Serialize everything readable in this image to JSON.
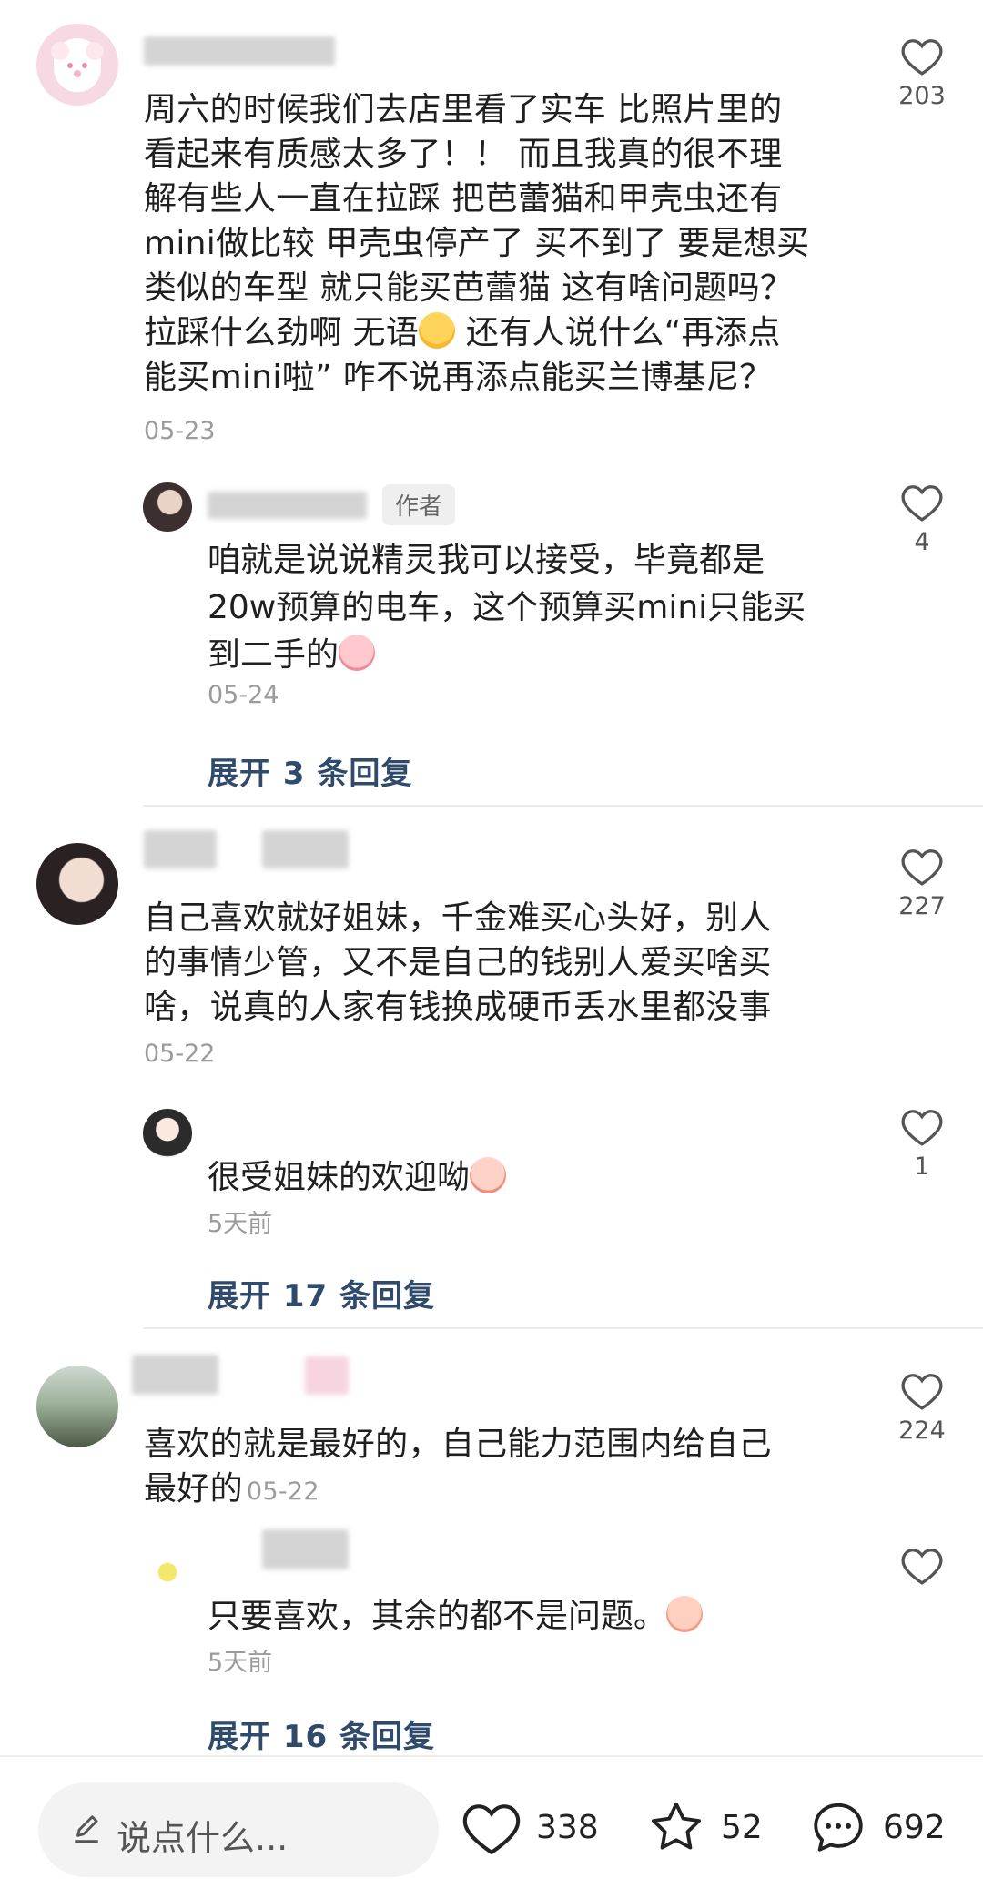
{
  "comments": [
    {
      "text": "周六的时候我们去店里看了实车 比照片里的\n看起来有质感太多了！！ 而且我真的很不理\n解有些人一直在拉踩 把芭蕾猫和甲壳虫还有\nmini做比较 甲壳虫停产了 买不到了 要是想买\n类似的车型 就只能买芭蕾猫 这有啥问题吗？\n拉踩什么劲啊 无语",
      "text_tail": " 还有人说什么“再添点\n能买mini啦” 咋不说再添点能买兰博基尼？",
      "date": "05-23",
      "likes": "203",
      "reply": {
        "badge": "作者",
        "text": "咱就是说说精灵我可以接受，毕竟都是\n20w预算的电车，这个预算买mini只能买\n到二手的",
        "date": "05-24",
        "likes": "4"
      },
      "expand": "展开 3 条回复"
    },
    {
      "text": "自己喜欢就好姐妹，千金难买心头好，别人\n的事情少管，又不是自己的钱别人爱买啥买\n啥，说真的人家有钱换成硬币丢水里都没事",
      "date": "05-22",
      "likes": "227",
      "reply": {
        "text": "很受姐妹的欢迎呦",
        "date": "5天前",
        "likes": "1"
      },
      "expand": "展开 17 条回复"
    },
    {
      "text": "喜欢的就是最好的，自己能力范围内给自己\n最好的",
      "date": "05-22",
      "likes": "224",
      "reply": {
        "text": "只要喜欢，其余的都不是问题。",
        "date": "5天前",
        "likes": ""
      },
      "expand": "展开 16 条回复"
    }
  ],
  "bottom_bar": {
    "placeholder": "说点什么...",
    "likes": "338",
    "stars": "52",
    "comments": "692"
  },
  "colors": {
    "expand_link": "#2f4a6b",
    "date": "#9b9b9b",
    "icon": "#555555"
  }
}
